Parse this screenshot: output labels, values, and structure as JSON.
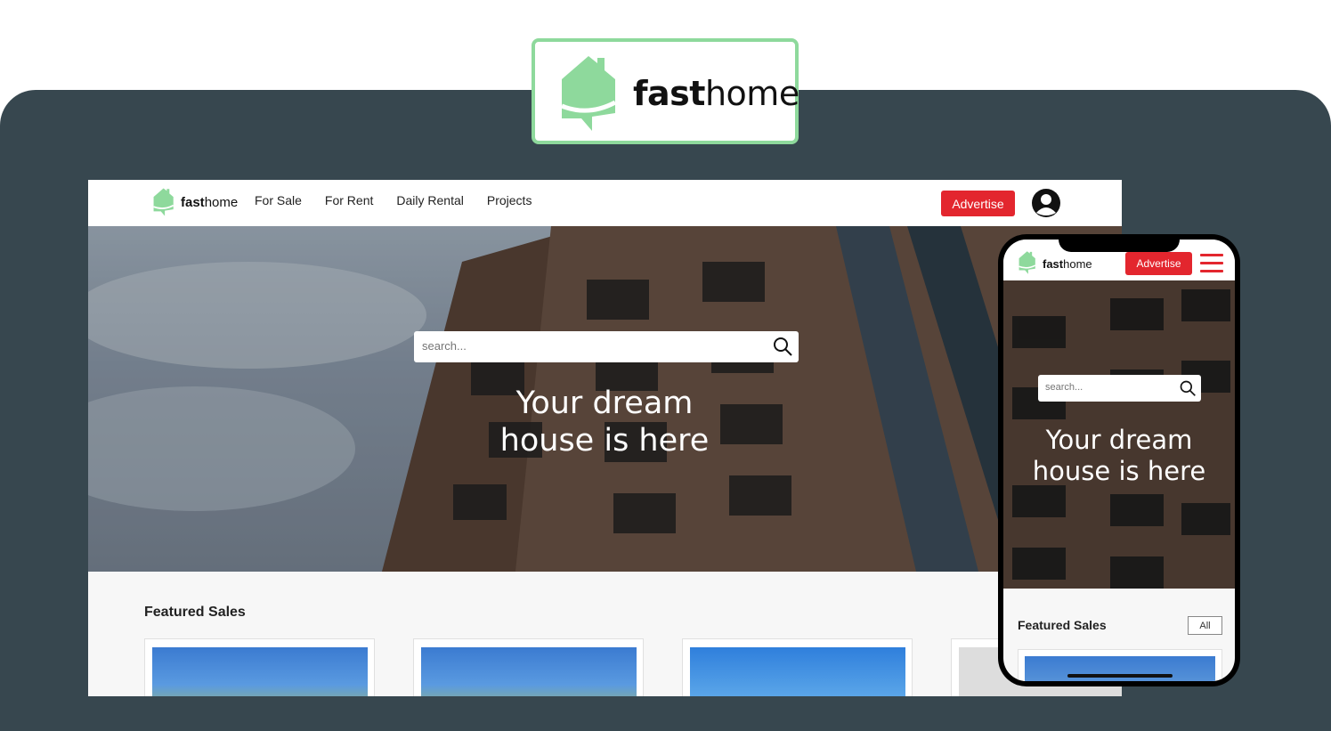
{
  "brand": {
    "bold": "fast",
    "light": "home",
    "color": "#8ed99c"
  },
  "desktop": {
    "nav": {
      "items": [
        "For Sale",
        "For Rent",
        "Daily Rental",
        "Projects"
      ],
      "advertise_label": "Advertise"
    },
    "search": {
      "placeholder": "search..."
    },
    "hero": {
      "title_line1": "Your dream",
      "title_line2": "house is here"
    },
    "featured": {
      "heading": "Featured Sales"
    }
  },
  "mobile": {
    "nav": {
      "advertise_label": "Advertise"
    },
    "search": {
      "placeholder": "search..."
    },
    "hero": {
      "title_line1": "Your dream",
      "title_line2": "house is here"
    },
    "featured": {
      "heading": "Featured Sales",
      "all_label": "All"
    }
  },
  "colors": {
    "accent_red": "#e3262e",
    "brand_green": "#8ed99c",
    "stage_bg": "#37474f"
  }
}
